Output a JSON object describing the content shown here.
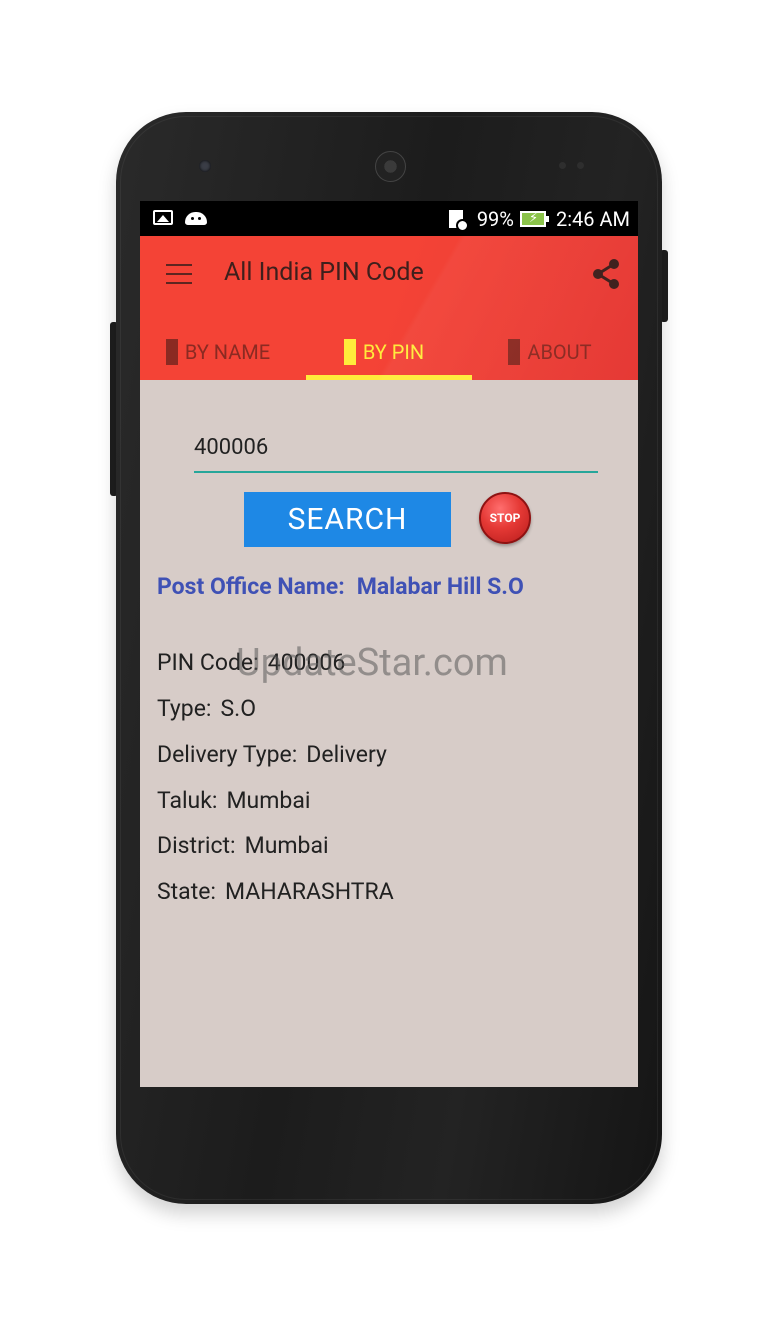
{
  "status_bar": {
    "battery_percent": "99%",
    "time": "2:46 AM",
    "icons": [
      "image-icon",
      "android-icon",
      "sd-card-icon",
      "battery-charging-icon"
    ]
  },
  "app_bar": {
    "title": "All India PIN Code",
    "menu_icon": "menu-icon",
    "share_icon": "share-icon",
    "background_color": "#f44336"
  },
  "tabs": [
    {
      "label": "BY NAME",
      "selected": false
    },
    {
      "label": "BY PIN",
      "selected": true
    },
    {
      "label": "ABOUT",
      "selected": false
    }
  ],
  "search": {
    "pin_value": "400006",
    "search_label": "SEARCH",
    "stop_label": "STOP"
  },
  "result": {
    "post_office_label": "Post Office Name:",
    "post_office_value": "Malabar Hill S.O",
    "details": [
      {
        "label": "PIN Code:",
        "value": "400006"
      },
      {
        "label": "Type:",
        "value": "S.O"
      },
      {
        "label": "Delivery Type:",
        "value": "Delivery"
      },
      {
        "label": "Taluk:",
        "value": "Mumbai"
      },
      {
        "label": "District:",
        "value": "Mumbai"
      },
      {
        "label": "State:",
        "value": "MAHARASHTRA"
      }
    ]
  },
  "watermark": "UpdateStar.com",
  "colors": {
    "accent": "#ffeb3b",
    "button_blue": "#1e88e5",
    "link_blue": "#3f51b5",
    "content_bg": "#d7ccc8"
  }
}
